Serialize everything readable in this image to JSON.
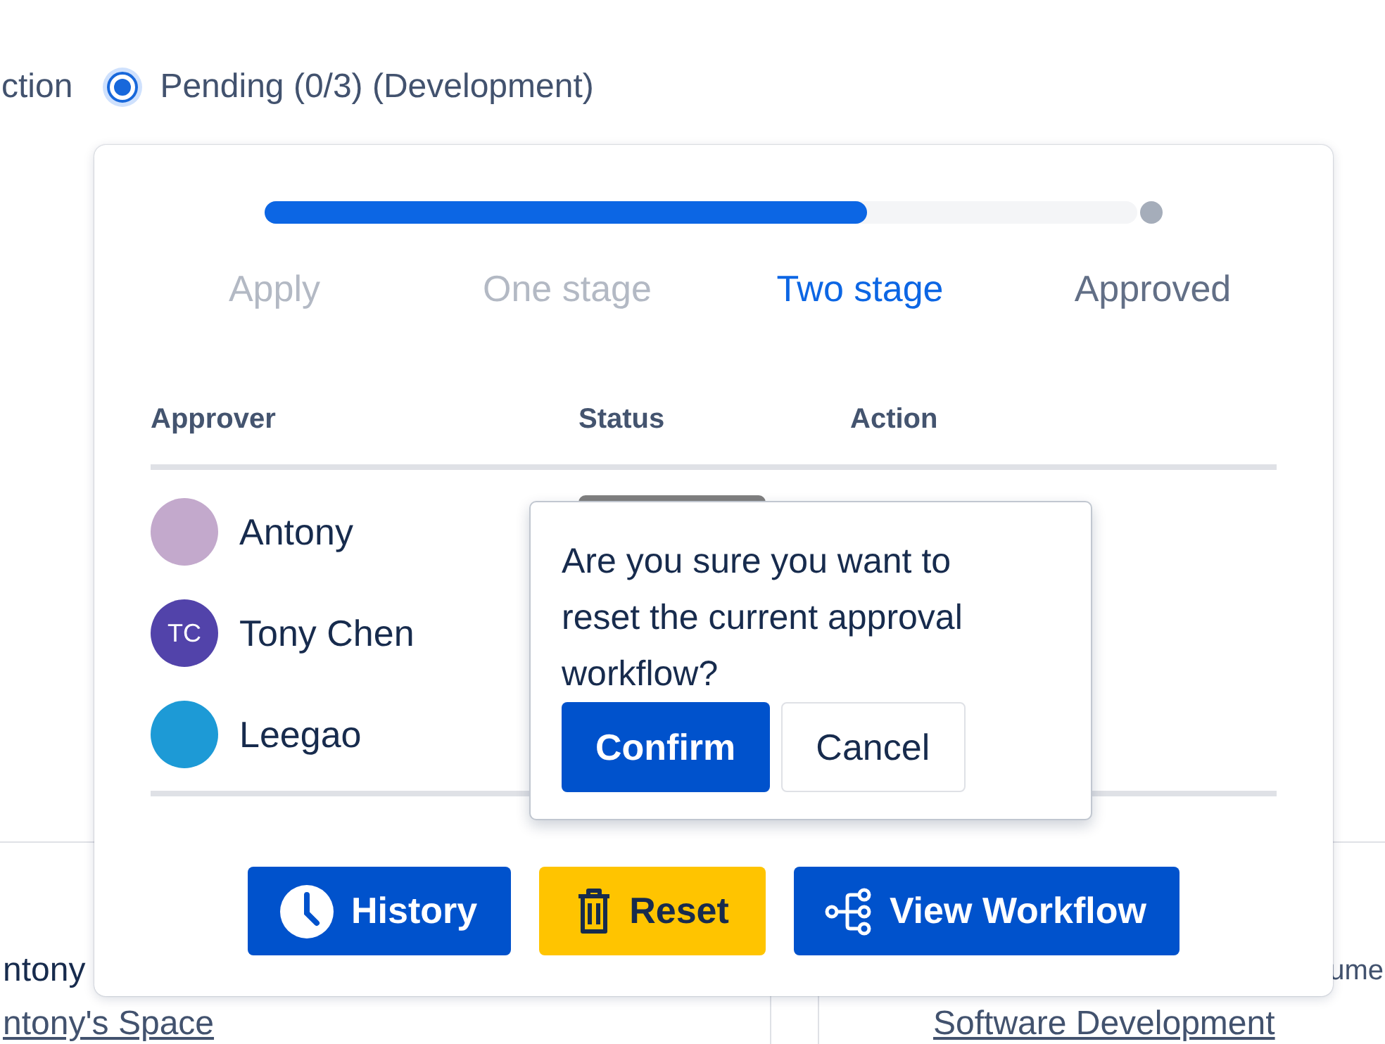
{
  "background": {
    "cut_option": "ction",
    "radio": {
      "label": "Pending (0/3) (Development)",
      "selected": true
    },
    "table_rows": [
      {
        "cell_1": "ntony",
        "cell_3": "ume"
      },
      {
        "cell_1": "ntony's Space",
        "cell_3": "Software Development"
      }
    ]
  },
  "approval_card": {
    "progress": {
      "level": 0.69
    },
    "steps": [
      {
        "label": "Apply",
        "kind": "done"
      },
      {
        "label": "One stage",
        "kind": "done"
      },
      {
        "label": "Two stage",
        "kind": "current"
      },
      {
        "label": "Approved",
        "kind": "pending"
      }
    ],
    "columns": [
      "Approver",
      "Status",
      "Action"
    ],
    "approvers": [
      {
        "name": "Antony",
        "avatar": {
          "kind": "image",
          "color": "#c3a9cc"
        }
      },
      {
        "name": "Tony Chen",
        "avatar": {
          "kind": "initials",
          "initials": "TC",
          "color": "#5243aa"
        }
      },
      {
        "name": "Leegao",
        "avatar": {
          "kind": "image",
          "color": "#1d9ad6"
        }
      }
    ],
    "buttons": [
      {
        "label": "History",
        "kind": "primary"
      },
      {
        "label": "Reset",
        "kind": "warning"
      },
      {
        "label": "View Workflow",
        "kind": "primary"
      }
    ]
  },
  "confirm_popover": {
    "message": "Are you sure you want to reset the current approval workflow?",
    "buttons": [
      {
        "label": "Confirm",
        "kind": "primary"
      },
      {
        "label": "Cancel",
        "kind": "secondary"
      }
    ]
  }
}
